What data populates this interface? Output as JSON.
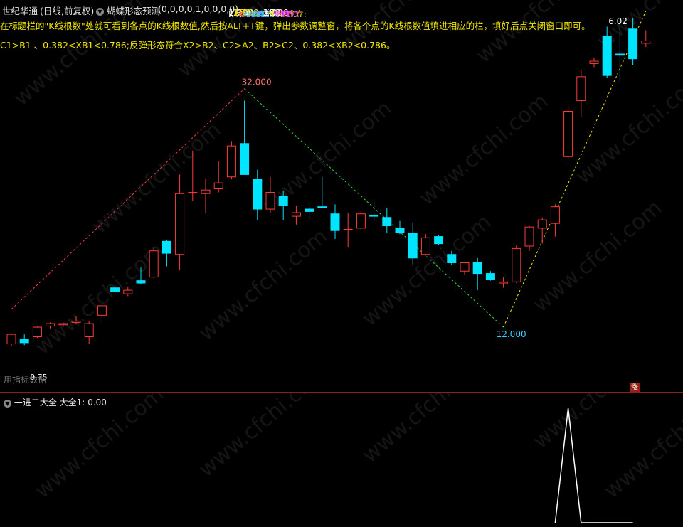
{
  "header": {
    "stock_name": "世纪华通",
    "stock_period": "(日线,前复权)",
    "indicator_name": "蝴蝶形态预测",
    "indicator_params": "(0,0,0,0,1,0,0,0,0)",
    "fields": [
      {
        "label": "K线根数:",
        "value": "1.000",
        "color": "#ffffff"
      },
      {
        "label": "XB1:",
        "value": "1.000",
        "color": "#f0e600"
      },
      {
        "label": "买入成立:",
        "value": "-",
        "color": "#ff3b3b"
      },
      {
        "label": "买D1:",
        "value": "-",
        "color": "#38c0ff"
      },
      {
        "label": "买D2:",
        "value": "-",
        "color": "#38c0ff"
      },
      {
        "label": "买D3:",
        "value": "-",
        "color": "#38c0ff"
      },
      {
        "label": "买D4:",
        "value": "-",
        "color": "#38c0ff"
      },
      {
        "label": "XB2:",
        "value": "1.000",
        "color": "#ffffff"
      },
      {
        "label": "卖出成立:",
        "value": "-",
        "color": "#f0e600"
      },
      {
        "label": "卖D1:",
        "value": "-",
        "color": "#ff3bff"
      },
      {
        "label": "卖D2:",
        "value": "-",
        "color": "#ff3bff"
      },
      {
        "label": "卖",
        "value": "",
        "color": "#ff3bff"
      }
    ]
  },
  "instructions": {
    "line1": "在标题栏的\"K线根数\"处就可看到各点的K线根数值,然后按ALT+T键，弹出参数调整窗，将各个点的K线根数值填进相应的栏，填好后点关闭窗口即可。",
    "line2": "C1>B1 、0.382<XB1<0.786;反弹形态符合X2>B2、C2>A2、B2>C2、0.382<XB2<0.786。"
  },
  "annotations": {
    "high_label": "32.000",
    "low_label": "12.000",
    "last_label": "6.02",
    "start_label": "9.75",
    "overlay_label": "用指标数据"
  },
  "badge": "涨",
  "sub_panel": {
    "indicator_name": "一进二大全",
    "value_label": "大全1:",
    "value": "0.00"
  },
  "watermark_text": "www.cfchi.com",
  "colors": {
    "up": "#ff3b3b",
    "down": "#00e5ff",
    "rise_line": "#ff3b3b",
    "fall_line": "#35d435",
    "final_line": "#f0e600",
    "indicator_line": "#ffffff"
  },
  "chart_data": {
    "type": "candlestick",
    "y_axis": {
      "min": 9.5,
      "max": 38
    },
    "candles": [
      {
        "o": 10.6,
        "h": 11.5,
        "l": 10.4,
        "c": 11.4
      },
      {
        "o": 11.0,
        "h": 11.4,
        "l": 10.5,
        "c": 10.7
      },
      {
        "o": 11.2,
        "h": 12.1,
        "l": 11.1,
        "c": 12.0
      },
      {
        "o": 12.1,
        "h": 12.4,
        "l": 11.9,
        "c": 12.3
      },
      {
        "o": 12.2,
        "h": 12.4,
        "l": 12.0,
        "c": 12.3
      },
      {
        "o": 12.4,
        "h": 12.9,
        "l": 12.3,
        "c": 12.5
      },
      {
        "o": 11.2,
        "h": 12.5,
        "l": 10.6,
        "c": 12.3
      },
      {
        "o": 13.0,
        "h": 13.9,
        "l": 12.4,
        "c": 13.8
      },
      {
        "o": 15.3,
        "h": 15.6,
        "l": 14.7,
        "c": 15.0
      },
      {
        "o": 14.8,
        "h": 15.4,
        "l": 14.6,
        "c": 15.1
      },
      {
        "o": 15.9,
        "h": 17.0,
        "l": 15.6,
        "c": 15.7
      },
      {
        "o": 16.2,
        "h": 18.7,
        "l": 16.1,
        "c": 18.4
      },
      {
        "o": 19.2,
        "h": 19.3,
        "l": 17.1,
        "c": 18.2
      },
      {
        "o": 18.1,
        "h": 24.8,
        "l": 16.8,
        "c": 23.2
      },
      {
        "o": 23.3,
        "h": 26.8,
        "l": 22.6,
        "c": 23.3
      },
      {
        "o": 23.2,
        "h": 24.4,
        "l": 21.6,
        "c": 23.5
      },
      {
        "o": 23.6,
        "h": 25.9,
        "l": 23.3,
        "c": 24.1
      },
      {
        "o": 24.6,
        "h": 27.6,
        "l": 24.4,
        "c": 27.2
      },
      {
        "o": 27.4,
        "h": 31.0,
        "l": 24.8,
        "c": 24.8
      },
      {
        "o": 24.4,
        "h": 25.2,
        "l": 21.0,
        "c": 21.9
      },
      {
        "o": 21.9,
        "h": 24.6,
        "l": 21.6,
        "c": 23.3
      },
      {
        "o": 23.0,
        "h": 23.4,
        "l": 21.0,
        "c": 22.2
      },
      {
        "o": 21.3,
        "h": 22.2,
        "l": 20.6,
        "c": 21.6
      },
      {
        "o": 21.9,
        "h": 22.3,
        "l": 21.0,
        "c": 21.7
      },
      {
        "o": 22.1,
        "h": 24.6,
        "l": 22.0,
        "c": 22.0
      },
      {
        "o": 21.5,
        "h": 22.3,
        "l": 19.4,
        "c": 20.1
      },
      {
        "o": 20.2,
        "h": 21.6,
        "l": 18.7,
        "c": 20.2
      },
      {
        "o": 20.3,
        "h": 21.8,
        "l": 20.1,
        "c": 21.5
      },
      {
        "o": 21.4,
        "h": 22.6,
        "l": 20.9,
        "c": 21.3
      },
      {
        "o": 21.2,
        "h": 22.0,
        "l": 19.9,
        "c": 20.5
      },
      {
        "o": 20.3,
        "h": 20.9,
        "l": 19.8,
        "c": 19.9
      },
      {
        "o": 19.9,
        "h": 20.8,
        "l": 17.2,
        "c": 17.8
      },
      {
        "o": 18.1,
        "h": 19.8,
        "l": 18.0,
        "c": 19.5
      },
      {
        "o": 19.6,
        "h": 19.7,
        "l": 18.9,
        "c": 19.0
      },
      {
        "o": 18.1,
        "h": 18.4,
        "l": 17.2,
        "c": 17.4
      },
      {
        "o": 16.7,
        "h": 17.5,
        "l": 16.4,
        "c": 17.4
      },
      {
        "o": 17.4,
        "h": 17.8,
        "l": 15.1,
        "c": 16.5
      },
      {
        "o": 16.5,
        "h": 16.7,
        "l": 15.9,
        "c": 16.0
      },
      {
        "o": 15.7,
        "h": 16.2,
        "l": 15.3,
        "c": 15.8
      },
      {
        "o": 15.8,
        "h": 18.9,
        "l": 15.7,
        "c": 18.6
      },
      {
        "o": 18.8,
        "h": 20.5,
        "l": 18.4,
        "c": 20.4
      },
      {
        "o": 20.3,
        "h": 21.2,
        "l": 19.0,
        "c": 21.0
      },
      {
        "o": 20.7,
        "h": 22.3,
        "l": 19.6,
        "c": 22.1
      },
      {
        "o": 26.3,
        "h": 30.7,
        "l": 25.9,
        "c": 30.1
      },
      {
        "o": 31.0,
        "h": 33.6,
        "l": 29.6,
        "c": 33.0
      },
      {
        "o": 34.1,
        "h": 34.6,
        "l": 33.8,
        "c": 34.3
      },
      {
        "o": 36.4,
        "h": 37.2,
        "l": 32.9,
        "c": 33.1
      },
      {
        "o": 34.9,
        "h": 38.0,
        "l": 32.6,
        "c": 34.8
      },
      {
        "o": 37.0,
        "h": 37.9,
        "l": 34.0,
        "c": 34.5
      },
      {
        "o": 35.8,
        "h": 36.9,
        "l": 35.5,
        "c": 36.0
      }
    ],
    "pattern_lines": [
      {
        "from": [
          0,
          13.5
        ],
        "to": [
          18,
          32.0
        ],
        "color_key": "rise_line"
      },
      {
        "from": [
          18,
          32.0
        ],
        "to": [
          38,
          12.0
        ],
        "color_key": "fall_line"
      },
      {
        "from": [
          38,
          12.0
        ],
        "to": [
          49,
          38.5
        ],
        "color_key": "final_line"
      }
    ]
  },
  "sub_chart": {
    "type": "line",
    "points": [
      0,
      0,
      0,
      0,
      0,
      0,
      0,
      0,
      0,
      0,
      0,
      0,
      0,
      0,
      0,
      0,
      0,
      0,
      0,
      0,
      0,
      0,
      0,
      0,
      0,
      0,
      0,
      0,
      0,
      0,
      0,
      0,
      0,
      0,
      0,
      0,
      0,
      0,
      0,
      0,
      0,
      0,
      0,
      1,
      0,
      0,
      0,
      0,
      0,
      0
    ],
    "start_index": 43,
    "ylim": [
      0,
      1
    ]
  }
}
